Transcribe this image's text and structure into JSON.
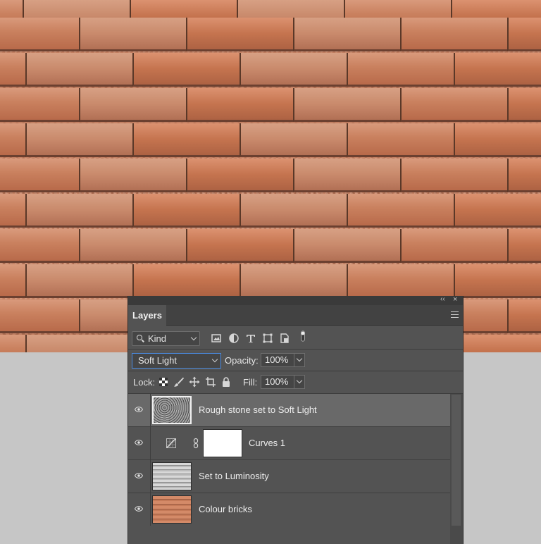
{
  "panel": {
    "tab_label": "Layers",
    "collapse_glyph": "‹‹",
    "close_glyph": "×"
  },
  "filter": {
    "kind_label": "Kind",
    "icons": [
      "pixel-filter-icon",
      "adjustment-filter-icon",
      "type-filter-icon",
      "shape-filter-icon",
      "smart-object-filter-icon",
      "filter-toggle-icon"
    ]
  },
  "blend": {
    "mode": "Soft Light",
    "opacity_label": "Opacity:",
    "opacity_value": "100%"
  },
  "lock": {
    "label": "Lock:",
    "icons": [
      "lock-transparent-icon",
      "lock-image-icon",
      "lock-position-icon",
      "lock-artboard-icon",
      "lock-all-icon"
    ],
    "fill_label": "Fill:",
    "fill_value": "100%"
  },
  "layers": [
    {
      "name": "Rough stone set to Soft Light",
      "selected": true,
      "visible": true,
      "thumb": "rough-stone"
    },
    {
      "name": "Curves 1",
      "selected": false,
      "visible": true,
      "thumb": "curves-mask"
    },
    {
      "name": "Set to Luminosity",
      "selected": false,
      "visible": true,
      "thumb": "luminosity"
    },
    {
      "name": "Colour bricks",
      "selected": false,
      "visible": true,
      "thumb": "bricks"
    }
  ],
  "colors": {
    "panel_bg": "#535353",
    "selected_layer": "#696969",
    "focus_border": "#4a8ae0",
    "brick": "#c87c5a"
  }
}
